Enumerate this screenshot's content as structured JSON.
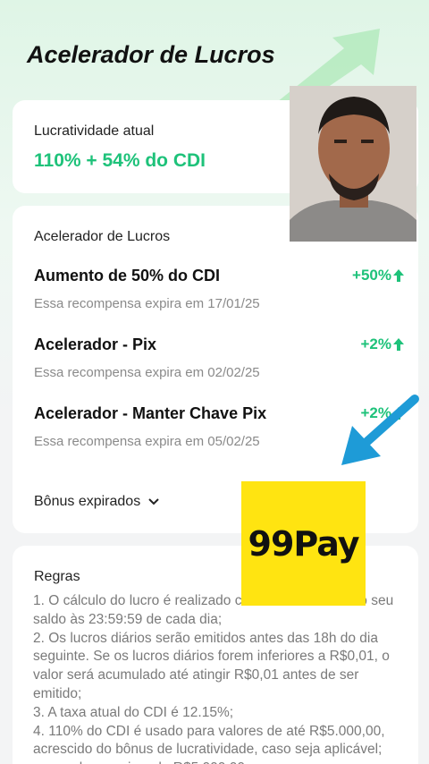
{
  "header": {
    "title": "Acelerador de Lucros"
  },
  "profit": {
    "label": "Lucratividade atual",
    "value": "110% + 54% do CDI"
  },
  "accelerator": {
    "title": "Acelerador de Lucros",
    "items": [
      {
        "name": "Aumento de 50% do CDI",
        "expiry": "Essa recompensa expira em 17/01/25",
        "pct": "+50%"
      },
      {
        "name": "Acelerador - Pix",
        "expiry": "Essa recompensa expira em 02/02/25",
        "pct": "+2%"
      },
      {
        "name": "Acelerador - Manter Chave Pix",
        "expiry": "Essa recompensa expira em 05/02/25",
        "pct": "+2%"
      }
    ],
    "expired_label": "Bônus expirados"
  },
  "rules": {
    "title": "Regras",
    "lines": [
      "1. O cálculo do lucro é realizado com base no valor do seu saldo às 23:59:59 de cada dia;",
      "2. Os lucros diários serão emitidos antes das 18h do dia seguinte. Se os lucros diários forem inferiores a R$0,01, o valor será acumulado até atingir R$0,01 antes de ser emitido;",
      "3. A taxa atual do CDI é 12.15%;",
      "4. 110% do CDI é usado para valores de até R$5.000,00, acrescido do bônus de lucratividade, caso seja aplicável; para valores acima de R$5.000,00"
    ]
  },
  "overlay": {
    "logo_text": "99Pay",
    "logo_color": "#ffe411",
    "arrow_color": "#1e9bd7"
  },
  "colors": {
    "accent": "#1ec27a"
  }
}
